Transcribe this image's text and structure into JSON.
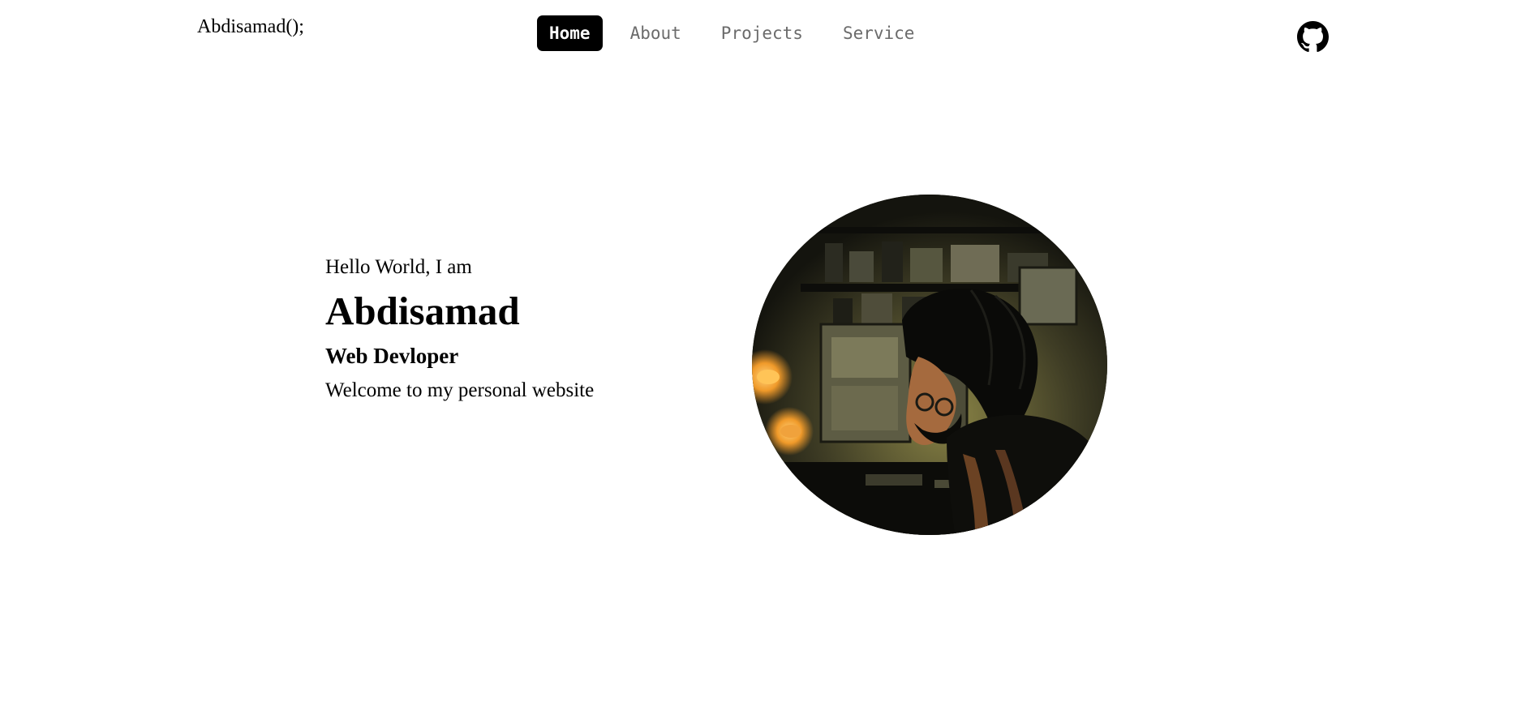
{
  "header": {
    "brand": "Abdisamad();",
    "nav": [
      {
        "label": "Home",
        "active": true
      },
      {
        "label": "About",
        "active": false
      },
      {
        "label": "Projects",
        "active": false
      },
      {
        "label": "Service",
        "active": false
      }
    ],
    "github_icon": "github-icon"
  },
  "hero": {
    "greeting": "Hello World, I am",
    "name": "Abdisamad",
    "role": "Web Devloper",
    "welcome": "Welcome to my personal website",
    "portrait_icon": "illustrated-portrait-image"
  },
  "colors": {
    "background": "#ffffff",
    "text": "#000000",
    "nav_active_bg": "#000000",
    "nav_active_text": "#ffffff",
    "nav_inactive_text": "#6b6b6b"
  }
}
